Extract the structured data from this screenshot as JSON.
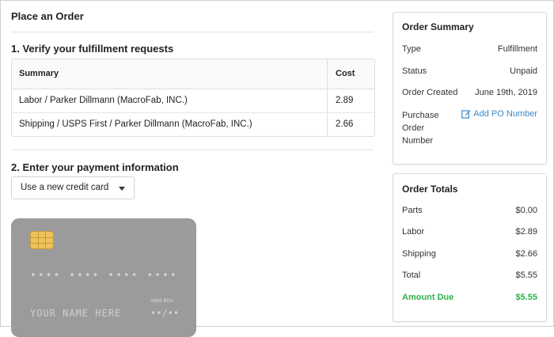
{
  "page": {
    "title": "Place an Order",
    "section1_title": "1. Verify your fulfillment requests",
    "section2_title": "2. Enter your payment information"
  },
  "table": {
    "headers": {
      "summary": "Summary",
      "cost": "Cost"
    },
    "rows": [
      {
        "summary": "Labor / Parker Dillmann (MacroFab, INC.)",
        "cost": "2.89"
      },
      {
        "summary": "Shipping / USPS First / Parker Dillmann (MacroFab, INC.)",
        "cost": "2.66"
      }
    ]
  },
  "payment": {
    "method_selected": "Use a new credit card",
    "card": {
      "number_placeholder": "•••• •••• •••• ••••",
      "name_placeholder": "YOUR NAME HERE",
      "valid_label": "valid thru",
      "valid_placeholder": "••/••"
    }
  },
  "order_summary": {
    "title": "Order Summary",
    "type_label": "Type",
    "type_value": "Fulfillment",
    "status_label": "Status",
    "status_value": "Unpaid",
    "created_label": "Order Created",
    "created_value": "June 19th, 2019",
    "po_label": "Purchase Order Number",
    "po_link": "Add PO Number"
  },
  "order_totals": {
    "title": "Order Totals",
    "parts_label": "Parts",
    "parts_value": "$0.00",
    "labor_label": "Labor",
    "labor_value": "$2.89",
    "shipping_label": "Shipping",
    "shipping_value": "$2.66",
    "total_label": "Total",
    "total_value": "$5.55",
    "due_label": "Amount Due",
    "due_value": "$5.55"
  },
  "icons": {
    "edit": "edit-icon",
    "caret": "chevron-down-icon"
  },
  "colors": {
    "link": "#3a87c8",
    "amount_due": "#2db34a",
    "card": "#9b9b9b",
    "chip": "#efc35b"
  }
}
